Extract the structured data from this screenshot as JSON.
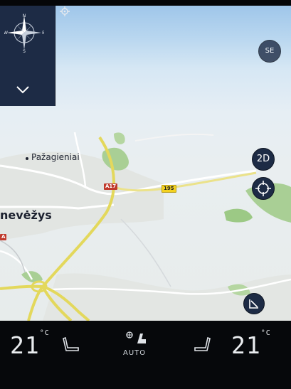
{
  "map": {
    "place_town": "Pažagieniai",
    "place_city": "nevėžys",
    "road_a17": "A17",
    "road_195": "195",
    "road_left": "A"
  },
  "controls": {
    "view_mode_label": "2D",
    "orientation_label": "SE"
  },
  "compass": {
    "n": "N",
    "s": "S",
    "e": "E",
    "w": "W"
  },
  "icons": {
    "compass": "compass-rose-icon",
    "collapse": "chevron-down-icon",
    "gps": "gps-crosshair-icon",
    "recenter": "crosshair-icon",
    "route": "route-arrow-icon",
    "seat_heat": "seat-heat-icon",
    "fan": "fan-icon",
    "position": "navigation-arrow-icon"
  },
  "climate": {
    "left_temp": "21",
    "right_temp": "21",
    "unit": "°C",
    "mode_label": "AUTO"
  },
  "colors": {
    "panel": "#1d2b45",
    "road_major": "#e6dc63",
    "road_minor": "#ffffff",
    "green_area": "#9cc985",
    "text_light": "#e9ecef"
  }
}
